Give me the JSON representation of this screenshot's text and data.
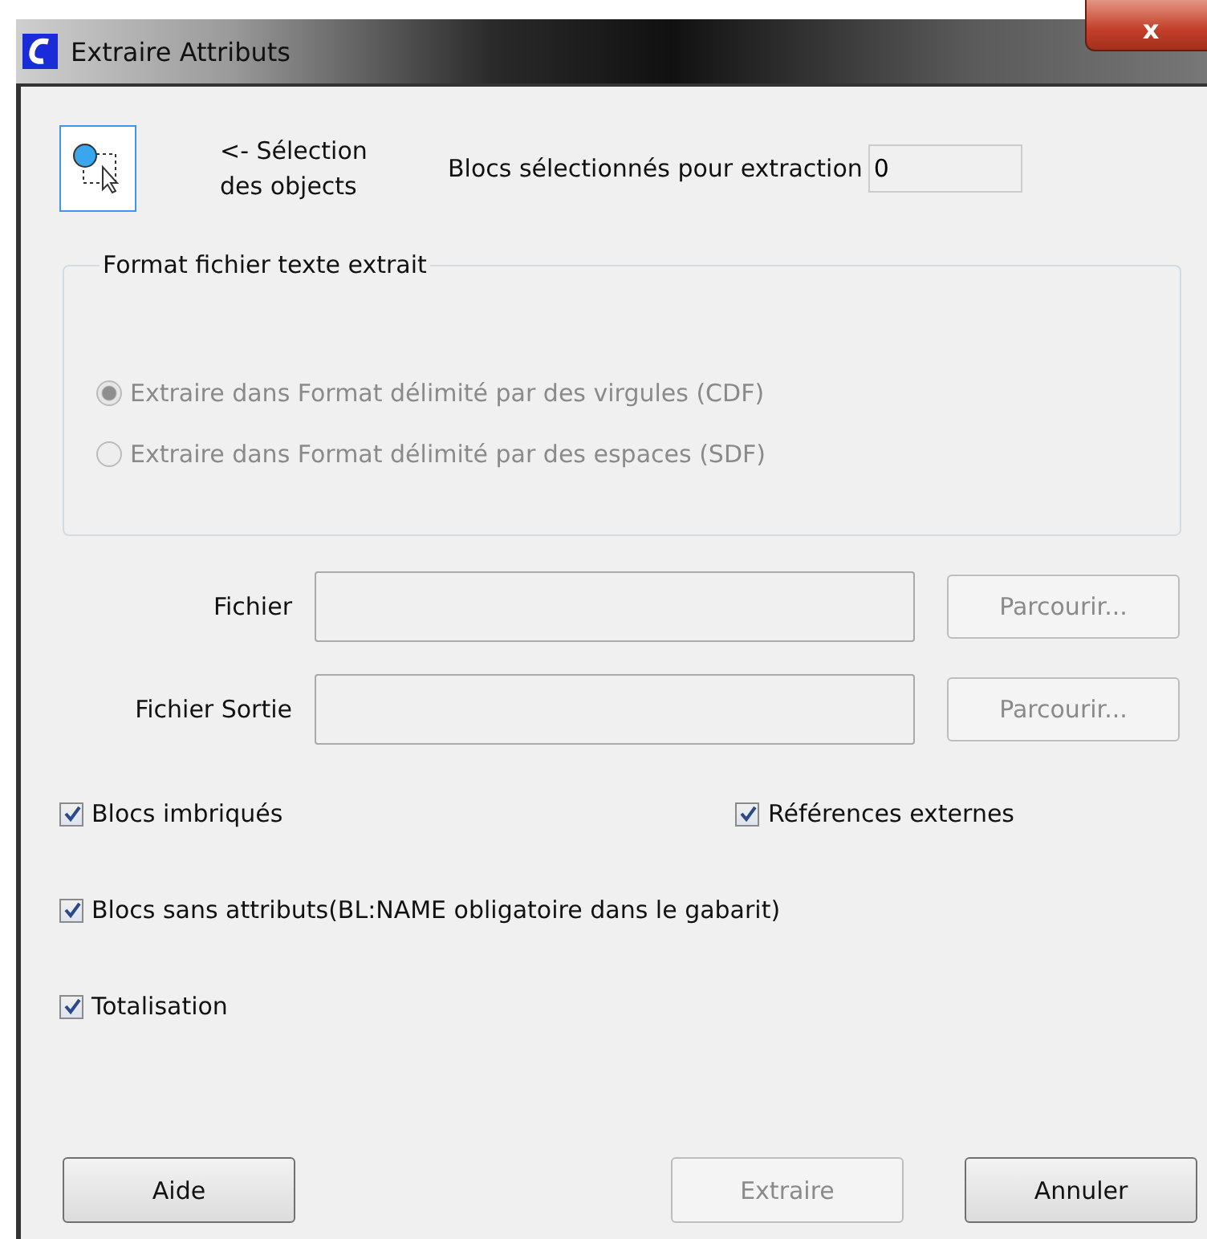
{
  "window": {
    "title": "Extraire Attributs",
    "close_button": "x"
  },
  "selection": {
    "label": "<- Sélection des objects",
    "count_label": "Blocs sélectionnés pour extraction",
    "count": "0"
  },
  "format_group": {
    "title": "Format fichier texte extrait",
    "disabled": true,
    "options": [
      {
        "label": "Extraire dans Format délimité par des virgules (CDF)",
        "selected": true
      },
      {
        "label": "Extraire dans Format délimité par des espaces (SDF)",
        "selected": false
      }
    ]
  },
  "files": [
    {
      "label": "Fichier",
      "button": "Parcourir...",
      "disabled": true
    },
    {
      "label": "Fichier Sortie",
      "button": "Parcourir...",
      "disabled": true
    }
  ],
  "checkboxes": [
    [
      {
        "label": "Blocs imbriqués",
        "checked": true
      },
      {
        "label": "Références externes",
        "checked": true
      }
    ],
    [
      {
        "label": "Blocs sans attributs(BL:NAME obligatoire dans le gabarit)",
        "checked": true
      }
    ],
    [
      {
        "label": "Totalisation",
        "checked": true
      }
    ]
  ],
  "buttons": [
    {
      "label": "Aide",
      "disabled": false
    },
    {
      "label": "Extraire",
      "disabled": true
    },
    {
      "label": "Annuler",
      "disabled": false
    }
  ]
}
